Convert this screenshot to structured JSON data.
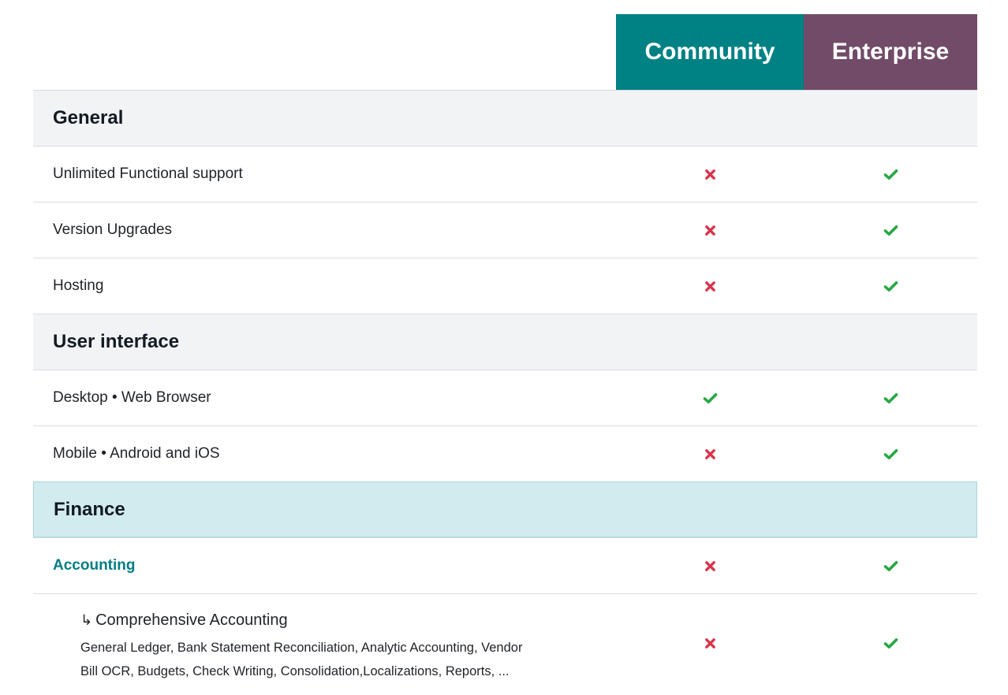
{
  "colors": {
    "community": "#008184",
    "enterprise": "#714b67",
    "cross": "#d9344a",
    "check": "#28a745",
    "link": "#017e84",
    "finance_bg": "#d2ebef"
  },
  "header": {
    "community": "Community",
    "enterprise": "Enterprise"
  },
  "rows": [
    {
      "type": "section",
      "label": "General"
    },
    {
      "type": "feature",
      "label": "Unlimited Functional support",
      "community": "cross",
      "enterprise": "check"
    },
    {
      "type": "feature",
      "label": "Version Upgrades",
      "community": "cross",
      "enterprise": "check"
    },
    {
      "type": "feature",
      "label": "Hosting",
      "community": "cross",
      "enterprise": "check"
    },
    {
      "type": "section",
      "label": "User interface"
    },
    {
      "type": "feature",
      "label": "Desktop • Web Browser",
      "community": "check",
      "enterprise": "check"
    },
    {
      "type": "feature",
      "label": "Mobile • Android and iOS",
      "community": "cross",
      "enterprise": "check"
    },
    {
      "type": "section",
      "label": "Finance"
    },
    {
      "type": "app",
      "label": "Accounting",
      "community": "cross",
      "enterprise": "check"
    },
    {
      "type": "subfeature",
      "arrow": "↳",
      "title": "Comprehensive Accounting",
      "description_line1": "General Ledger, Bank Statement Reconciliation, Analytic Accounting, Vendor",
      "description_line2": "Bill OCR, Budgets, Check Writing, Consolidation,Localizations, Reports, ...",
      "community": "cross",
      "enterprise": "check"
    }
  ]
}
